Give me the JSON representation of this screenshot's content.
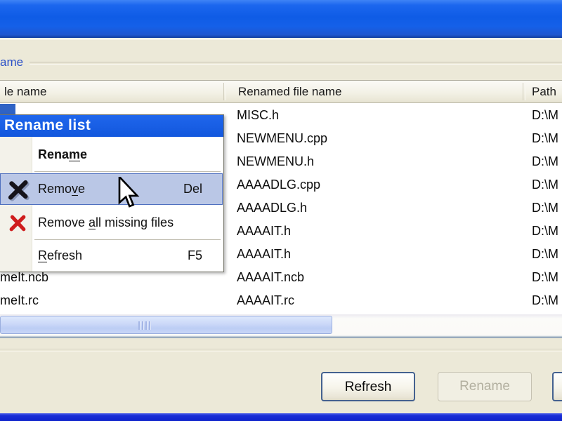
{
  "colors": {
    "titlebar_blue": "#0f5ce6",
    "bottom_border_blue": "#0f24cc",
    "dialog_beige": "#ece9d8",
    "menu_title_blue": "#1660e8",
    "menu_highlight": "#bac7e6",
    "menu_highlight_border": "#4f70bf",
    "selection_blue": "#2f63c5"
  },
  "group": {
    "label_fragment": "ame"
  },
  "list": {
    "columns": [
      {
        "label": "le name"
      },
      {
        "label": "Renamed file name"
      },
      {
        "label": "Path"
      }
    ],
    "rows": [
      {
        "file": "",
        "renamed": "MISC.h",
        "path": "D:\\M"
      },
      {
        "file": "",
        "renamed": "NEWMENU.cpp",
        "path": "D:\\M"
      },
      {
        "file": "",
        "renamed": "NEWMENU.h",
        "path": "D:\\M"
      },
      {
        "file": "",
        "renamed": "AAAADLG.cpp",
        "path": "D:\\M"
      },
      {
        "file": "",
        "renamed": "AAAADLG.h",
        "path": "D:\\M"
      },
      {
        "file": "",
        "renamed": "AAAAIT.h",
        "path": "D:\\M"
      },
      {
        "file": "",
        "renamed": "AAAAIT.h",
        "path": "D:\\M"
      },
      {
        "file": "meIt.ncb",
        "renamed": "AAAAIT.ncb",
        "path": "D:\\M"
      },
      {
        "file": "meIt.rc",
        "renamed": "AAAAIT.rc",
        "path": "D:\\M"
      }
    ]
  },
  "context_menu": {
    "title": "Rename list",
    "items": [
      {
        "pre": "Rena",
        "mnemonic": "m",
        "post": "e",
        "shortcut": "",
        "icon": ""
      },
      {
        "pre": "Remo",
        "mnemonic": "v",
        "post": "e",
        "shortcut": "Del",
        "icon": "black-x-icon",
        "highlighted": "true"
      },
      {
        "pre": "Remove ",
        "mnemonic": "a",
        "post": "ll missing files",
        "shortcut": "",
        "icon": "red-x-icon"
      },
      {
        "pre": "",
        "mnemonic": "R",
        "post": "efresh",
        "shortcut": "F5",
        "icon": ""
      }
    ]
  },
  "buttons": {
    "refresh": {
      "label": "Refresh",
      "enabled": "true"
    },
    "rename": {
      "label": "Rename",
      "enabled": "false"
    },
    "partial": {
      "label": "",
      "enabled": "true"
    }
  }
}
